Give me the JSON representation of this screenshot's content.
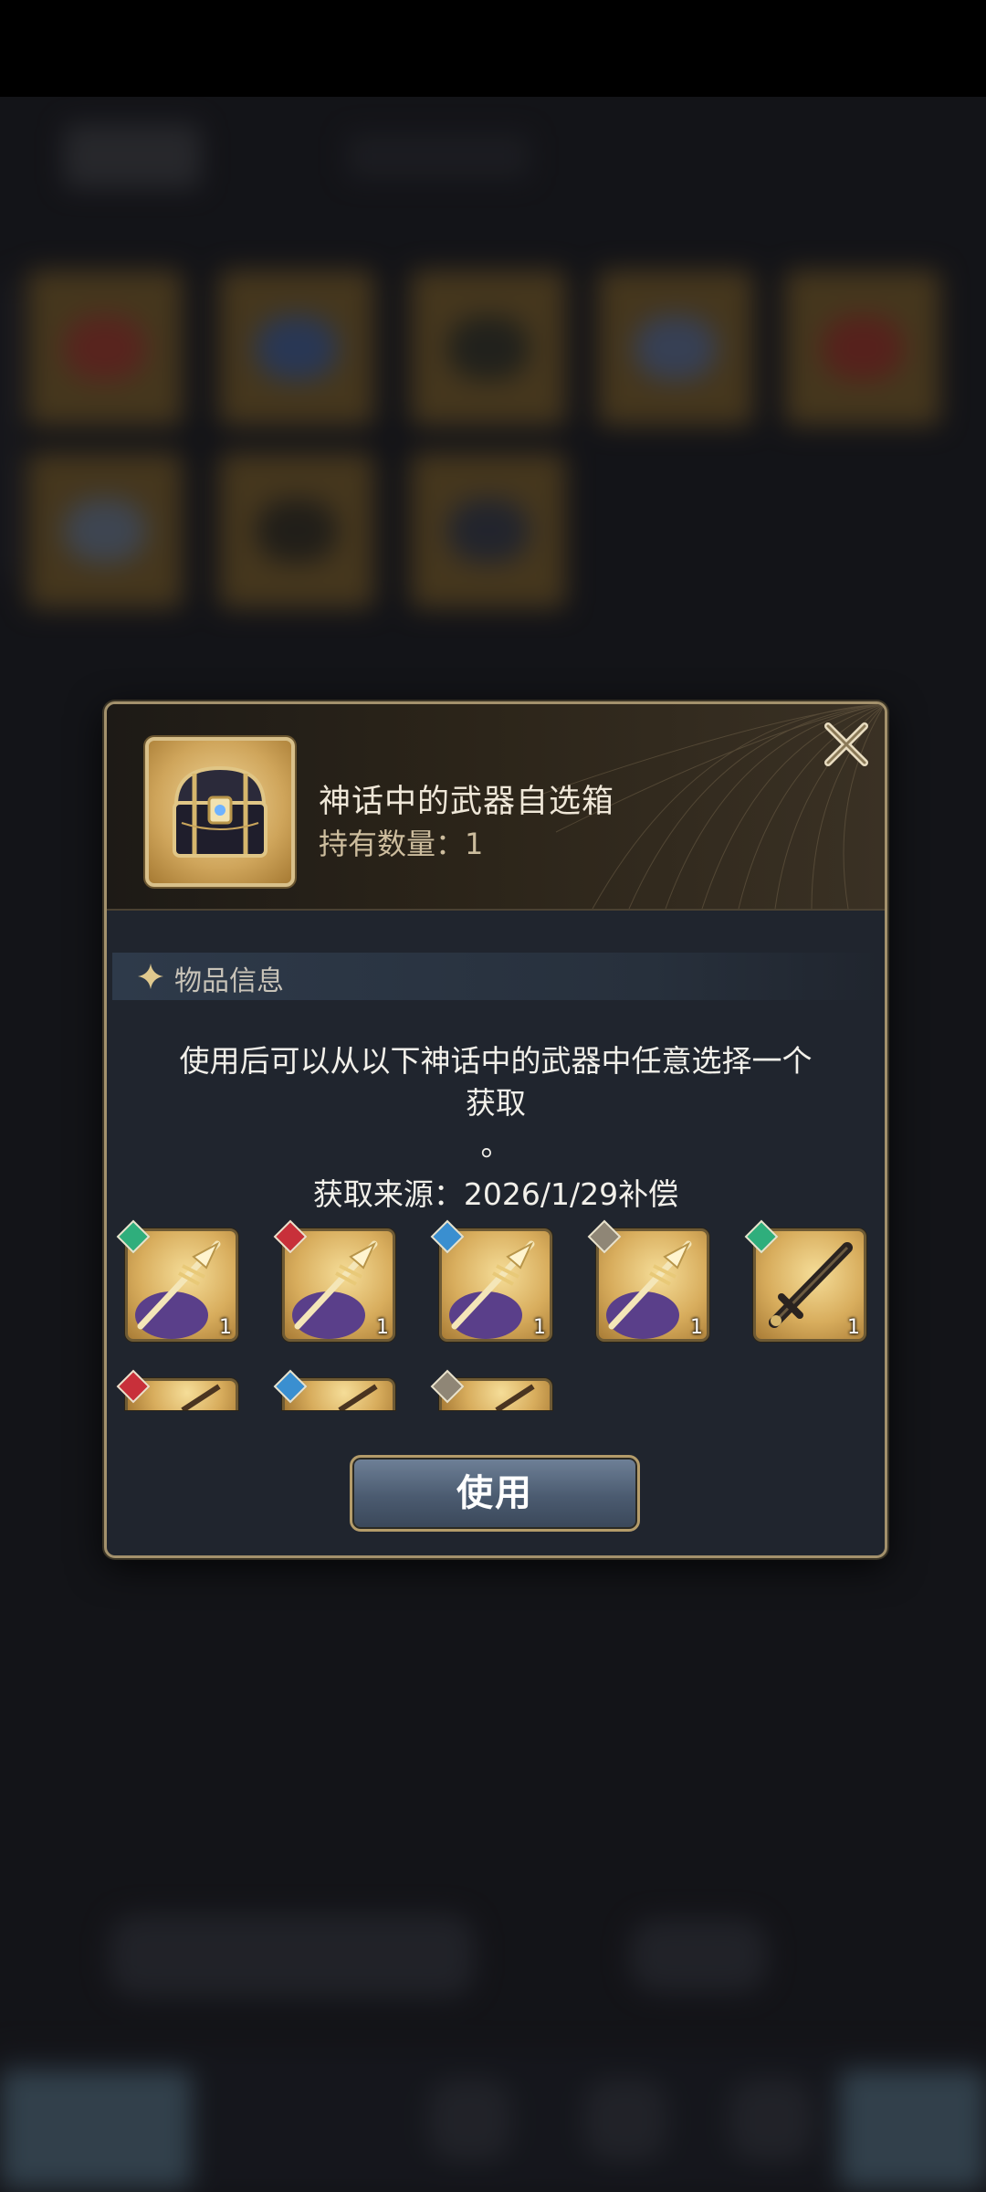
{
  "dialog": {
    "item_name": "神话中的武器自选箱",
    "item_count": "持有数量：1",
    "close_glyph": "X",
    "section_title": "物品信息",
    "description_line1": "使用后可以从以下神话中的武器中任意选择一个",
    "description_line2": "获取",
    "description_dot": "。",
    "source": "获取来源：2026/1/29补偿",
    "use_button": "使用"
  },
  "rewards": [
    {
      "icon": "spear-weapon-icon",
      "element_color": "#2fae7c",
      "qty": "1"
    },
    {
      "icon": "spear-weapon-icon",
      "element_color": "#c8303a",
      "qty": "1"
    },
    {
      "icon": "spear-weapon-icon",
      "element_color": "#3a8fd0",
      "qty": "1"
    },
    {
      "icon": "spear-weapon-icon",
      "element_color": "#8f8676",
      "qty": "1"
    },
    {
      "icon": "sword-weapon-icon",
      "element_color": "#2fae7c",
      "qty": "1"
    },
    {
      "icon": "weapon-icon",
      "element_color": "#c8303a",
      "qty": ""
    },
    {
      "icon": "weapon-icon",
      "element_color": "#3a8fd0",
      "qty": ""
    },
    {
      "icon": "weapon-icon",
      "element_color": "#8f8676",
      "qty": ""
    }
  ],
  "colors": {
    "dialog_border": "#a3916c",
    "dialog_bg": "#20252e",
    "button_top": "#6f8198"
  }
}
